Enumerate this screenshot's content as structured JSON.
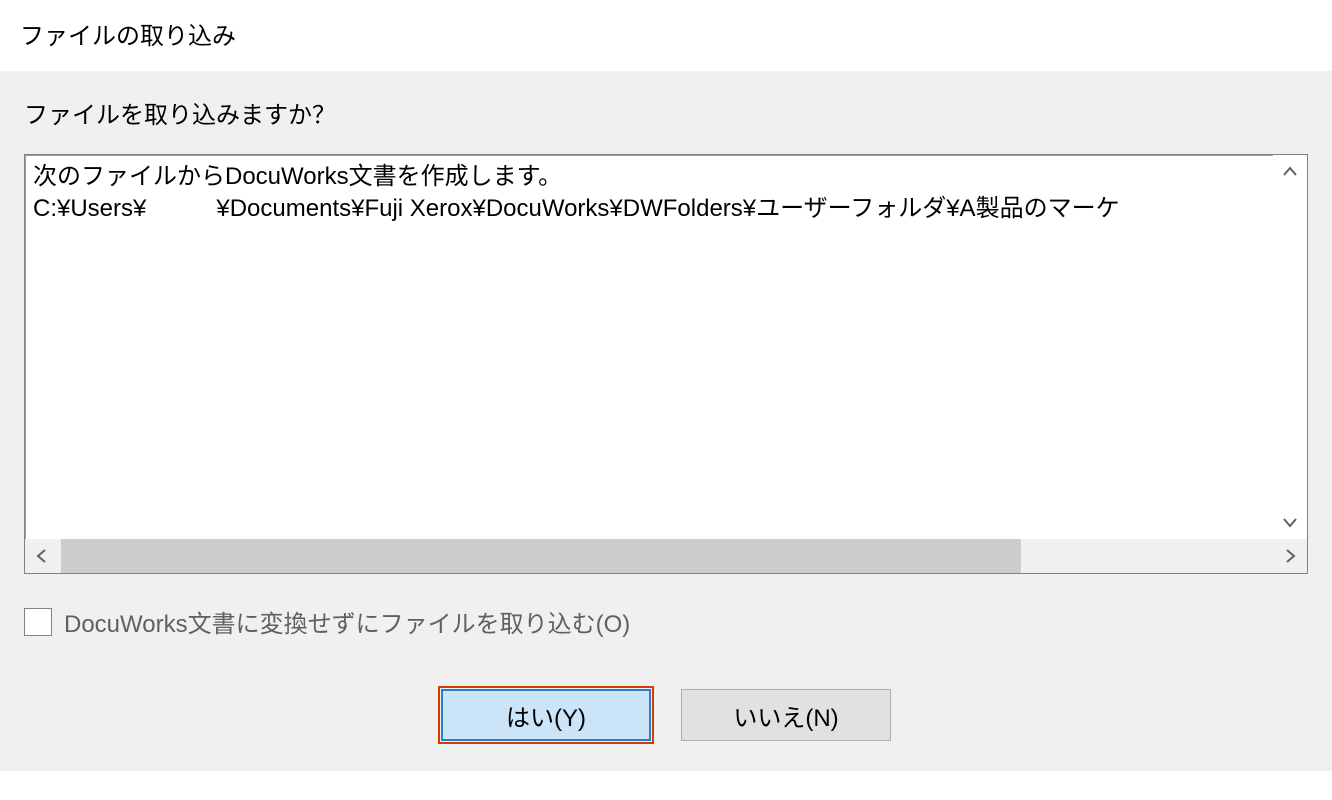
{
  "title": "ファイルの取り込み",
  "question": "ファイルを取り込みますか？",
  "message": {
    "line1": "次のファイルからDocuWorks文書を作成します。",
    "path_prefix": "C:¥Users¥",
    "path_suffix": "¥Documents¥Fuji Xerox¥DocuWorks¥DWFolders¥ユーザーフォルダ¥A製品のマーケ"
  },
  "checkbox": {
    "label": "DocuWorks文書に変換せずにファイルを取り込む(O)",
    "checked": false
  },
  "buttons": {
    "yes": "はい(Y)",
    "no": "いいえ(N)"
  }
}
